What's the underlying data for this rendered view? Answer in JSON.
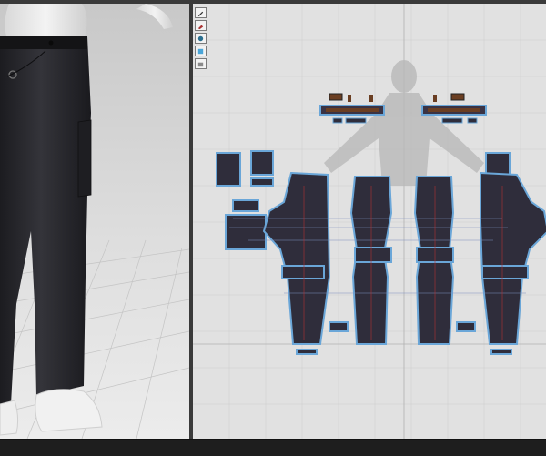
{
  "app": {
    "viewports": [
      {
        "id": "3d-view",
        "kind": "3D garment view"
      },
      {
        "id": "2d-view",
        "kind": "2D pattern view"
      }
    ]
  },
  "toolbar": {
    "tools": [
      {
        "icon": "pen-tool-icon"
      },
      {
        "icon": "brush-tool-icon"
      },
      {
        "icon": "search-tool-icon"
      },
      {
        "icon": "cube-tool-icon"
      },
      {
        "icon": "texture-tool-icon"
      }
    ]
  },
  "colors": {
    "fabric_dark": "#2f2d3b",
    "selection_outline": "#6aa6d8",
    "grid_bg": "#e1e1e1",
    "grid_line": "#cdcdcd",
    "trim_brown": "#6a3e22",
    "avatar_silhouette": "#b9b9b9"
  },
  "status_bar": {
    "text": ""
  }
}
